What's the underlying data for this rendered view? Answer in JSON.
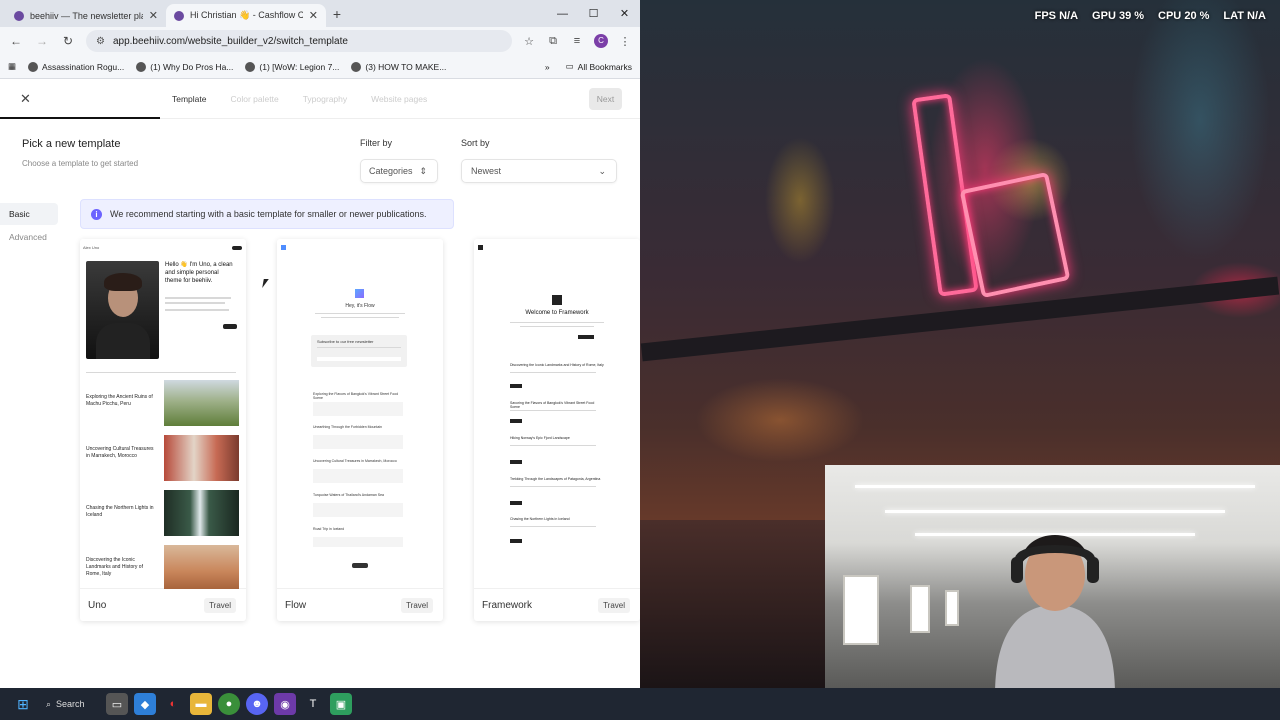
{
  "browser": {
    "tabs": [
      {
        "title": "beehiiv — The newsletter platfo",
        "active": false
      },
      {
        "title": "Hi Christian 👋 - Cashflow Coll",
        "active": true
      }
    ],
    "url": "app.beehiiv.com/website_builder_v2/switch_template",
    "profile_initial": "C",
    "bookmarks": [
      "Assassination Rogu...",
      "(1) Why Do Pros Ha...",
      "(1) [WoW: Legion 7...",
      "(3) HOW TO MAKE..."
    ],
    "all_bookmarks": "All Bookmarks",
    "more_bookmarks": "»"
  },
  "wizard": {
    "steps": [
      {
        "label": "Template",
        "current": true
      },
      {
        "label": "Color palette",
        "current": false
      },
      {
        "label": "Typography",
        "current": false
      },
      {
        "label": "Website pages",
        "current": false
      }
    ],
    "next_label": "Next",
    "progress_fraction": 0.25
  },
  "picker": {
    "title": "Pick a new template",
    "subtitle": "Choose a template to get started",
    "filter_label": "Filter by",
    "filter_value": "Categories",
    "sort_label": "Sort by",
    "sort_value": "Newest",
    "side_tabs": [
      {
        "label": "Basic",
        "selected": true
      },
      {
        "label": "Advanced",
        "selected": false
      }
    ],
    "banner": "We recommend starting with a basic template for smaller or newer publications."
  },
  "templates": [
    {
      "name": "Uno",
      "tag": "Travel",
      "preview": {
        "author": "Alex Uno",
        "hero_title": "Hello 👋 I'm Uno, a clean and simple personal theme for beehiiv.",
        "posts": [
          "Exploring the Ancient Ruins of Machu Picchu, Peru",
          "Uncovering Cultural Treasures in Marrakech, Morocco",
          "Chasing the Northern Lights in Iceland",
          "Discovering the Iconic Landmarks and History of Rome, Italy"
        ]
      }
    },
    {
      "name": "Flow",
      "tag": "Travel",
      "preview": {
        "hero_title": "Hey, it's Flow",
        "subscribe_title": "Subscribe to our free newsletter",
        "posts": [
          "Exploring the Flavors of Bangkok's Vibrant Street Food Scene",
          "Unearthing Through the Forbidden Mountain",
          "Uncovering Cultural Treasures in Marrakech, Morocco",
          "Turquoise Waters of Thailand's Andaman Sea",
          "Road Trip in Iceland"
        ]
      }
    },
    {
      "name": "Framework",
      "tag": "Travel",
      "preview": {
        "hero_title": "Welcome to Framework",
        "posts": [
          "Discovering the Iconic Landmarks and History of Rome, Italy",
          "Savoring the Flavors of Bangkok's Vibrant Street Food Scene",
          "Hiking Norway's Epic Fjord Landscape",
          "Trekking Through the Landscapes of Patagonia, Argentina",
          "Chasing the Northern Lights in Iceland"
        ]
      }
    }
  ],
  "overlay": {
    "fps_label": "FPS",
    "fps_value": "N/A",
    "gpu_label": "GPU",
    "gpu_value": "39 %",
    "cpu_label": "CPU",
    "cpu_value": "20 %",
    "lat_label": "LAT",
    "lat_value": "N/A"
  },
  "taskbar": {
    "search_label": "Search"
  }
}
